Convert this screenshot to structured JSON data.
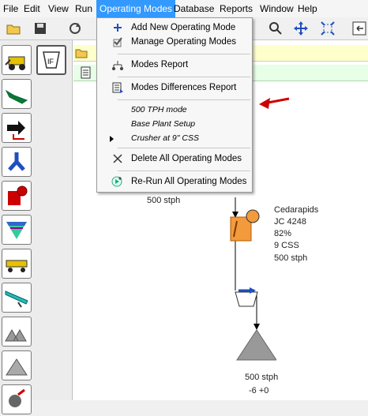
{
  "menubar": [
    "File",
    "Edit",
    "View",
    "Run",
    "Operating Modes",
    "Database",
    "Reports",
    "Window",
    "Help"
  ],
  "active_menu": "Operating Modes",
  "accent_color": "#3399ff",
  "dropdown": {
    "items": [
      {
        "label": "Add New Operating Mode",
        "icon": "plus-icon"
      },
      {
        "label": "Manage Operating Modes",
        "icon": "check-icon"
      },
      {
        "label": "Modes Report",
        "icon": "report-icon"
      },
      {
        "label": "Modes Differences Report",
        "icon": "differences-report-icon"
      },
      {
        "label": "500 TPH mode",
        "icon": ""
      },
      {
        "label": "Base Plant Setup",
        "icon": ""
      },
      {
        "label": "Crusher at 9\" CSS",
        "icon": "active-mode-arrow-icon"
      },
      {
        "label": "Delete All Operating Modes",
        "icon": "delete-x-icon"
      },
      {
        "label": "Re-Run All Operating Modes",
        "icon": "rerun-icon"
      }
    ]
  },
  "canvas": {
    "label_top": "500 stph",
    "crusher": {
      "name": "Cedarapids",
      "model": "JC 4248",
      "percent": "82%",
      "css": "9 CSS",
      "rate": "500 stph"
    },
    "pile": {
      "rate": "500 stph",
      "offset": "-6 +0"
    }
  }
}
